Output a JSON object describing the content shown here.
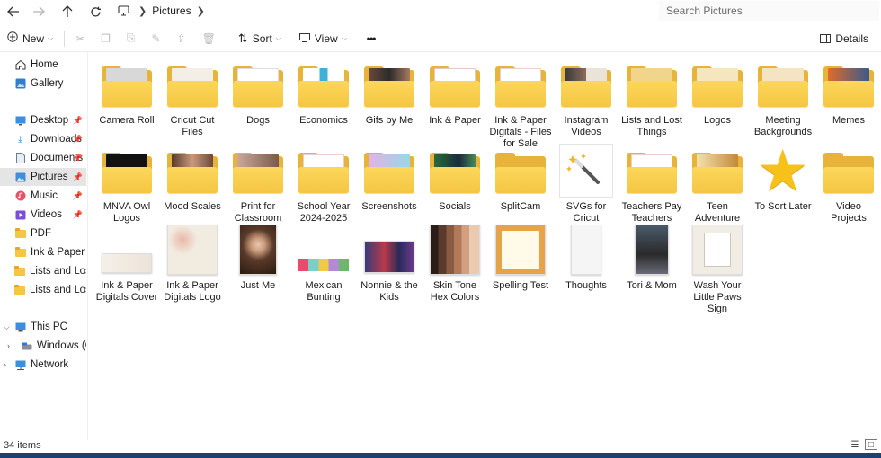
{
  "address": {
    "crumbs": [
      "Pictures"
    ],
    "search_placeholder": "Search Pictures"
  },
  "commands": {
    "new": "New",
    "sort": "Sort",
    "view": "View",
    "more": "•••",
    "details": "Details"
  },
  "sidebar": {
    "items": [
      {
        "label": "Home",
        "icon": "home-icon"
      },
      {
        "label": "Gallery",
        "icon": "gallery-icon"
      },
      {
        "label": "Desktop",
        "icon": "desktop-icon"
      },
      {
        "label": "Downloads",
        "icon": "download-icon"
      },
      {
        "label": "Documents",
        "icon": "documents-icon"
      },
      {
        "label": "Pictures",
        "icon": "pictures-icon"
      },
      {
        "label": "Music",
        "icon": "music-icon"
      },
      {
        "label": "Videos",
        "icon": "videos-icon"
      },
      {
        "label": "PDF",
        "icon": "folder-icon"
      },
      {
        "label": "Ink & Paper",
        "icon": "folder-icon"
      },
      {
        "label": "Lists and Lost Thing",
        "icon": "folder-icon"
      },
      {
        "label": "Lists and Lost Thing",
        "icon": "folder-icon"
      },
      {
        "label": "This PC",
        "icon": "pc-icon"
      },
      {
        "label": "Windows (C:)",
        "icon": "drive-icon"
      },
      {
        "label": "Network",
        "icon": "network-icon"
      }
    ]
  },
  "files": [
    {
      "name": "Camera Roll",
      "kind": "folder"
    },
    {
      "name": "Cricut Cut Files",
      "kind": "folder"
    },
    {
      "name": "Dogs",
      "kind": "folder"
    },
    {
      "name": "Economics",
      "kind": "folder"
    },
    {
      "name": "Gifs by Me",
      "kind": "folder"
    },
    {
      "name": "Ink & Paper",
      "kind": "folder"
    },
    {
      "name": "Ink & Paper Digitals - Files for Sale",
      "kind": "folder"
    },
    {
      "name": "Instagram Videos",
      "kind": "folder"
    },
    {
      "name": "Lists and Lost Things",
      "kind": "folder"
    },
    {
      "name": "Logos",
      "kind": "folder"
    },
    {
      "name": "Meeting Backgrounds",
      "kind": "folder"
    },
    {
      "name": "Memes",
      "kind": "folder"
    },
    {
      "name": "MNVA Owl Logos",
      "kind": "folder"
    },
    {
      "name": "Mood Scales",
      "kind": "folder"
    },
    {
      "name": "Print for Classroom",
      "kind": "folder"
    },
    {
      "name": "School Year 2024-2025",
      "kind": "folder"
    },
    {
      "name": "Screenshots",
      "kind": "folder"
    },
    {
      "name": "Socials",
      "kind": "folder"
    },
    {
      "name": "SplitCam",
      "kind": "folder"
    },
    {
      "name": "SVGs for Cricut",
      "kind": "wand"
    },
    {
      "name": "Teachers Pay Teachers",
      "kind": "folder"
    },
    {
      "name": "Teen Adventure Pack",
      "kind": "folder"
    },
    {
      "name": "To Sort Later",
      "kind": "star"
    },
    {
      "name": "Video Projects",
      "kind": "folder"
    },
    {
      "name": "Ink & Paper Digitals Cover",
      "kind": "image"
    },
    {
      "name": "Ink & Paper Digitals Logo",
      "kind": "image"
    },
    {
      "name": "Just Me",
      "kind": "image"
    },
    {
      "name": "Mexican Bunting",
      "kind": "image"
    },
    {
      "name": "Nonnie & the Kids",
      "kind": "image"
    },
    {
      "name": "Skin Tone Hex Colors",
      "kind": "image"
    },
    {
      "name": "Spelling Test",
      "kind": "image"
    },
    {
      "name": "Thoughts",
      "kind": "image"
    },
    {
      "name": "Tori & Mom",
      "kind": "image"
    },
    {
      "name": "Wash Your Little Paws Sign",
      "kind": "image"
    }
  ],
  "status": {
    "count": "34 items"
  }
}
